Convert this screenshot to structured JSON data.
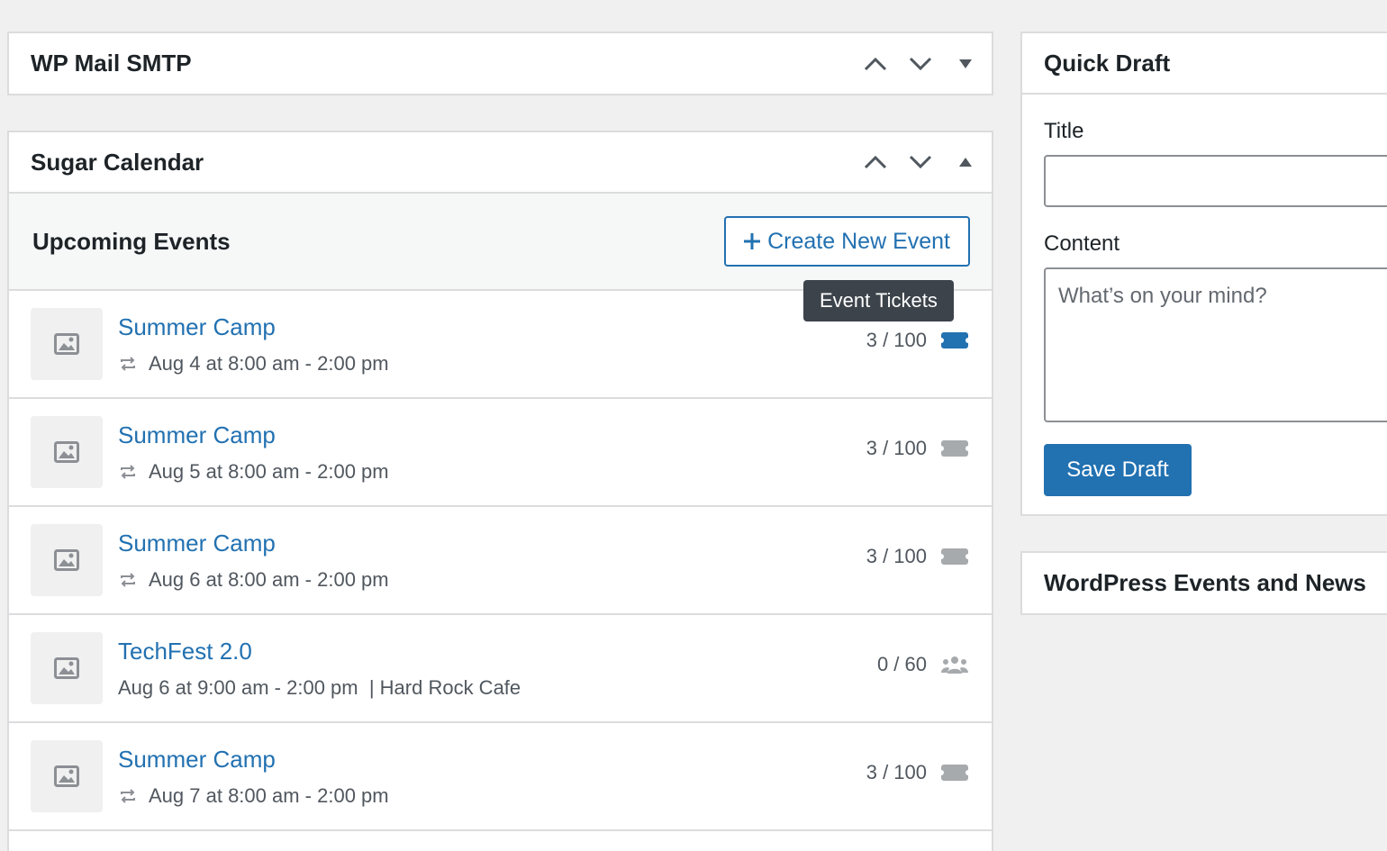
{
  "widgets": {
    "wp_mail_smtp": {
      "title": "WP Mail SMTP"
    },
    "sugar_calendar": {
      "title": "Sugar Calendar",
      "upcoming_title": "Upcoming Events",
      "create_button": "Create New Event",
      "tooltip": "Event Tickets",
      "events": [
        {
          "title": "Summer Camp",
          "date": "Aug 4 at 8:00 am - 2:00 pm",
          "count": "3 / 100",
          "icon": "ticket-icon",
          "icon_active": true,
          "recurring": true
        },
        {
          "title": "Summer Camp",
          "date": "Aug 5 at 8:00 am - 2:00 pm",
          "count": "3 / 100",
          "icon": "ticket-icon",
          "icon_active": false,
          "recurring": true
        },
        {
          "title": "Summer Camp",
          "date": "Aug 6 at 8:00 am - 2:00 pm",
          "count": "3 / 100",
          "icon": "ticket-icon",
          "icon_active": false,
          "recurring": true
        },
        {
          "title": "TechFest 2.0",
          "date": "Aug 6 at 9:00 am - 2:00 pm  | Hard Rock Cafe",
          "count": "0 / 60",
          "icon": "group-icon",
          "icon_active": false,
          "recurring": false
        },
        {
          "title": "Summer Camp",
          "date": "Aug 7 at 8:00 am - 2:00 pm",
          "count": "3 / 100",
          "icon": "ticket-icon",
          "icon_active": false,
          "recurring": true
        }
      ]
    },
    "quick_draft": {
      "title": "Quick Draft",
      "title_label": "Title",
      "title_value": "",
      "content_label": "Content",
      "content_placeholder": "What’s on your mind?",
      "save_button": "Save Draft"
    },
    "wp_events_news": {
      "title": "WordPress Events and News"
    }
  },
  "colors": {
    "accent": "#2271b1",
    "icon_inactive": "#a7aaad",
    "border": "#dcdcde",
    "background": "#f0f0f1"
  }
}
